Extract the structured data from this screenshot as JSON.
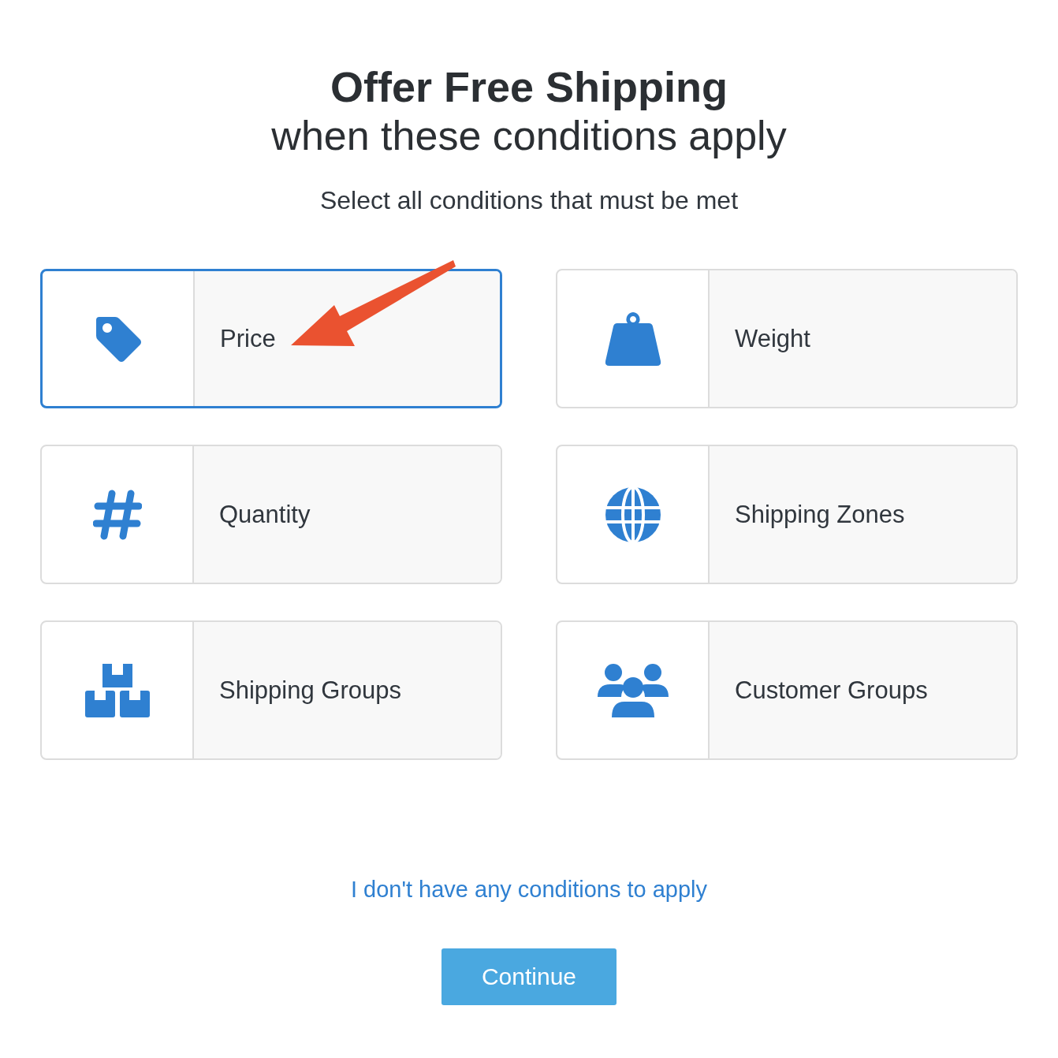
{
  "title": "Offer Free Shipping",
  "subtitle": "when these conditions apply",
  "instruction": "Select all conditions that must be met",
  "conditions": [
    {
      "label": "Price",
      "kind": "tag",
      "selected": true
    },
    {
      "label": "Weight",
      "kind": "weight",
      "selected": false
    },
    {
      "label": "Quantity",
      "kind": "hash",
      "selected": false
    },
    {
      "label": "Shipping Zones",
      "kind": "globe",
      "selected": false
    },
    {
      "label": "Shipping Groups",
      "kind": "boxes",
      "selected": false
    },
    {
      "label": "Customer Groups",
      "kind": "people",
      "selected": false
    }
  ],
  "skip_link": "I don't have any conditions to apply",
  "continue_button": "Continue"
}
